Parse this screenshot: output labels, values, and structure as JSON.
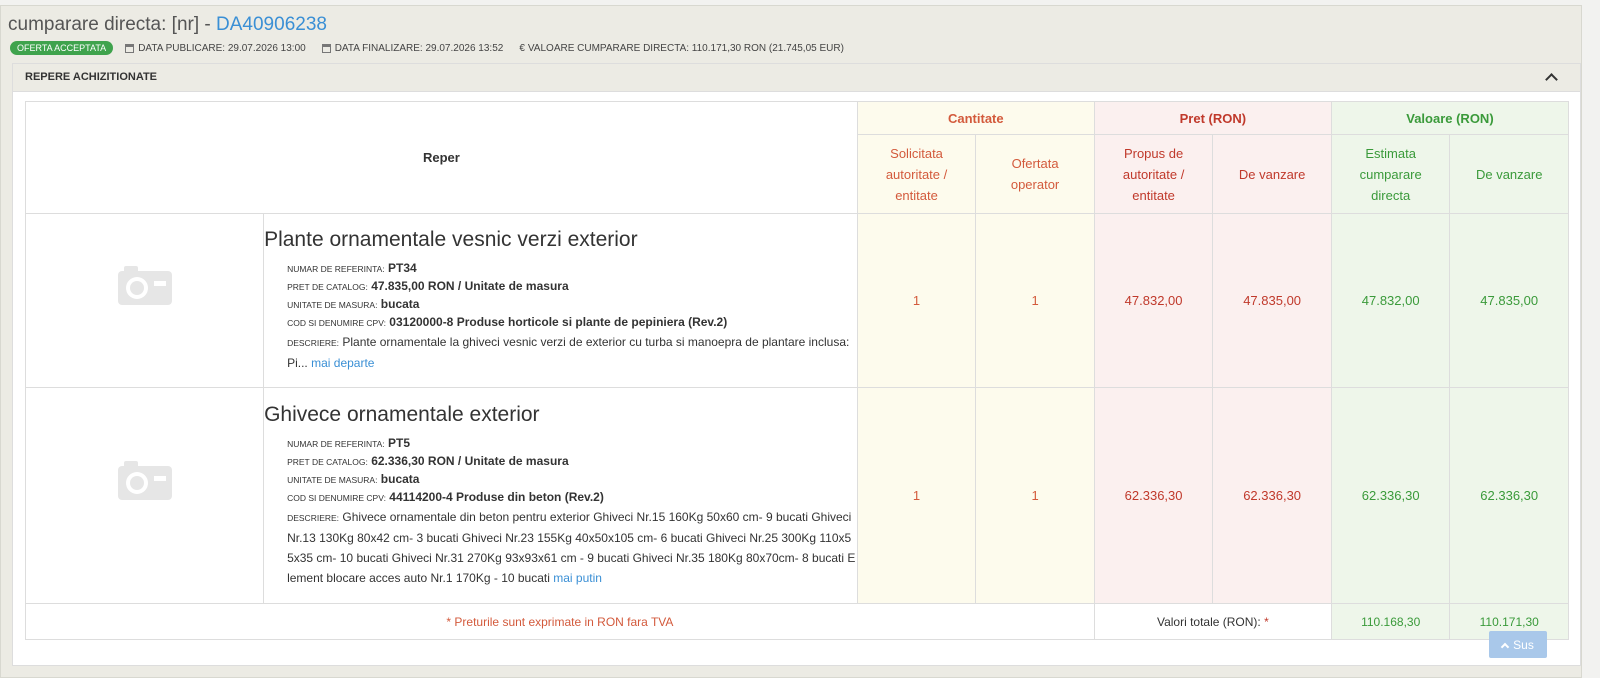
{
  "header": {
    "title_prefix": "cumparare directa: [nr] - ",
    "title_code": "DA40906238",
    "status_badge": "OFERTA ACCEPTATA",
    "publish_date": "DATA PUBLICARE: 29.07.2026 13:00",
    "finalize_date": "DATA FINALIZARE: 29.07.2026 13:52",
    "value_symbol": "€",
    "value_text": "VALOARE CUMPARARE DIRECTA: 110.171,30  RON (21.745,05  EUR)"
  },
  "panel": {
    "title": "REPERE ACHIZITIONATE"
  },
  "table": {
    "reper_header": "Reper",
    "groups": {
      "cantitate": "Cantitate",
      "pret": "Pret (RON)",
      "valoare": "Valoare (RON)"
    },
    "sub_headers": {
      "solicitata": "Solicitata autoritate / entitate",
      "ofertata": "Ofertata operator",
      "propus": "Propus de autoritate / entitate",
      "pret_vanzare": "De vanzare",
      "estimata": "Estimata cumparare directa",
      "valoare_vanzare": "De vanzare"
    },
    "rows": [
      {
        "name": "Plante ornamentale vesnic verzi exterior",
        "ref_label": "NUMAR DE REFERINTA:",
        "ref_value": "PT34",
        "catalog_label": "PRET DE CATALOG:",
        "catalog_value": "47.835,00  RON / Unitate de masura",
        "unit_label": "UNITATE DE MASURA:",
        "unit_value": "bucata",
        "cpv_label": "COD SI DENUMIRE CPV:",
        "cpv_value": "03120000-8 Produse horticole si plante de pepiniera (Rev.2)",
        "desc_label": "DESCRIERE:",
        "desc_value": "Plante ornamentale la ghiveci vesnic verzi de exterior cu turba si manoepra de plantare inclusa: Pi...",
        "desc_link": "mai departe",
        "qty_requested": "1",
        "qty_offered": "1",
        "price_proposed": "47.832,00",
        "price_sale": "47.835,00",
        "value_estimated": "47.832,00",
        "value_sale": "47.835,00"
      },
      {
        "name": "Ghivece ornamentale exterior",
        "ref_label": "NUMAR DE REFERINTA:",
        "ref_value": "PT5",
        "catalog_label": "PRET DE CATALOG:",
        "catalog_value": "62.336,30  RON / Unitate de masura",
        "unit_label": "UNITATE DE MASURA:",
        "unit_value": "bucata",
        "cpv_label": "COD SI DENUMIRE CPV:",
        "cpv_value": "44114200-4 Produse din beton (Rev.2)",
        "desc_label": "DESCRIERE:",
        "desc_value": "Ghivece ornamentale din beton pentru exterior Ghiveci Nr.15 160Kg 50x60 cm- 9 bucati Ghiveci Nr.13 130Kg 80x42 cm- 3 bucati Ghiveci Nr.23 155Kg 40x50x105 cm- 6 bucati Ghiveci Nr.25 300Kg 110x55x35 cm- 10 bucati Ghiveci Nr.31 270Kg 93x93x61 cm - 9 bucati Ghiveci Nr.35 180Kg 80x70cm- 8 bucati Element blocare acces auto Nr.1 170Kg - 10 bucati",
        "desc_link": "mai putin",
        "qty_requested": "1",
        "qty_offered": "1",
        "price_proposed": "62.336,30",
        "price_sale": "62.336,30",
        "value_estimated": "62.336,30",
        "value_sale": "62.336,30"
      }
    ],
    "footer": {
      "note": "* Preturile sunt exprimate in RON fara TVA",
      "totals_label": "Valori totale (RON):",
      "totals_star": "*",
      "total_estimated": "110.168,30",
      "total_sale": "110.171,30"
    }
  },
  "scroll_top": {
    "label": "Sus"
  }
}
